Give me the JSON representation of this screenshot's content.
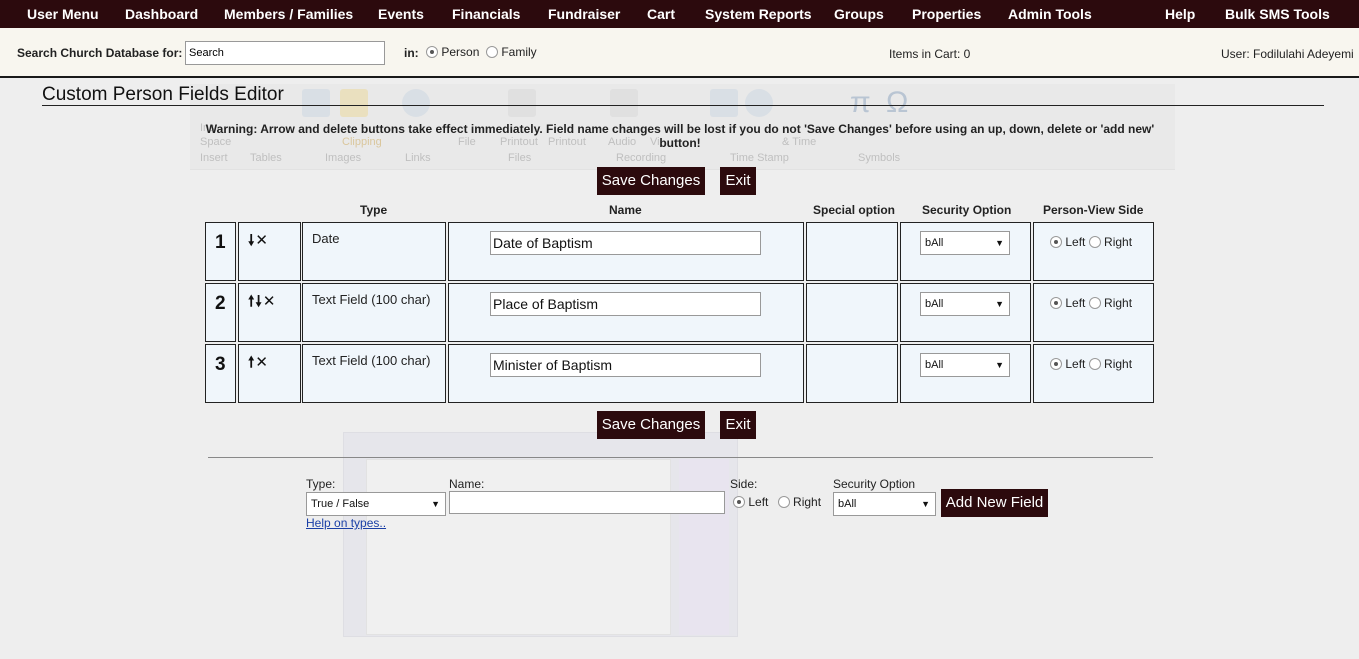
{
  "nav": [
    "User Menu",
    "Dashboard",
    "Members / Families",
    "Events",
    "Financials",
    "Fundraiser",
    "Cart",
    "System Reports",
    "Groups",
    "Properties",
    "Admin Tools",
    "Help",
    "Bulk SMS Tools"
  ],
  "search": {
    "label": "Search Church Database for:",
    "value": "Search",
    "in_label": "in:",
    "opt_person": "Person",
    "opt_family": "Family",
    "cart": "Items in Cart: 0",
    "user": "User: Fodilulahi Adeyemi"
  },
  "page": {
    "title": "Custom Person Fields Editor",
    "warning": "Warning: Arrow and delete buttons take effect immediately. Field name changes will be lost if you do not 'Save Changes' before using an up, down, delete or 'add new' button!",
    "save": "Save Changes",
    "exit": "Exit"
  },
  "ghost": {
    "labels": [
      "Ins",
      "Space",
      "Insert",
      "Tables",
      "Images",
      "Clipping",
      "Links",
      "File",
      "Printout",
      "Printout",
      "Files",
      "Audio",
      "Vi",
      "Recording",
      "& Time",
      "Time Stamp",
      "Symbols"
    ]
  },
  "table": {
    "headers": [
      "Type",
      "Name",
      "Special option",
      "Security Option",
      "Person-View Side"
    ],
    "rows": [
      {
        "num": "1",
        "arrows": "🠗✕",
        "type": "Date",
        "name": "Date of Baptism",
        "security": "bAll",
        "left": "Left",
        "right": "Right"
      },
      {
        "num": "2",
        "arrows": "🠕🠗✕",
        "type": "Text Field (100 char)",
        "name": "Place of Baptism",
        "security": "bAll",
        "left": "Left",
        "right": "Right"
      },
      {
        "num": "3",
        "arrows": "🠕✕",
        "type": "Text Field (100 char)",
        "name": "Minister of Baptism",
        "security": "bAll",
        "left": "Left",
        "right": "Right"
      }
    ]
  },
  "addnew": {
    "type_label": "Type:",
    "type_value": "True / False",
    "name_label": "Name:",
    "side_label": "Side:",
    "left": "Left",
    "right": "Right",
    "security_label": "Security Option",
    "security_value": "bAll",
    "button": "Add New Field",
    "help": "Help on types.."
  },
  "colors": {
    "nav_bg": "#2c0a0d",
    "searchbar_bg": "#f8f6ef",
    "row_bg": "#f0f6fb"
  }
}
